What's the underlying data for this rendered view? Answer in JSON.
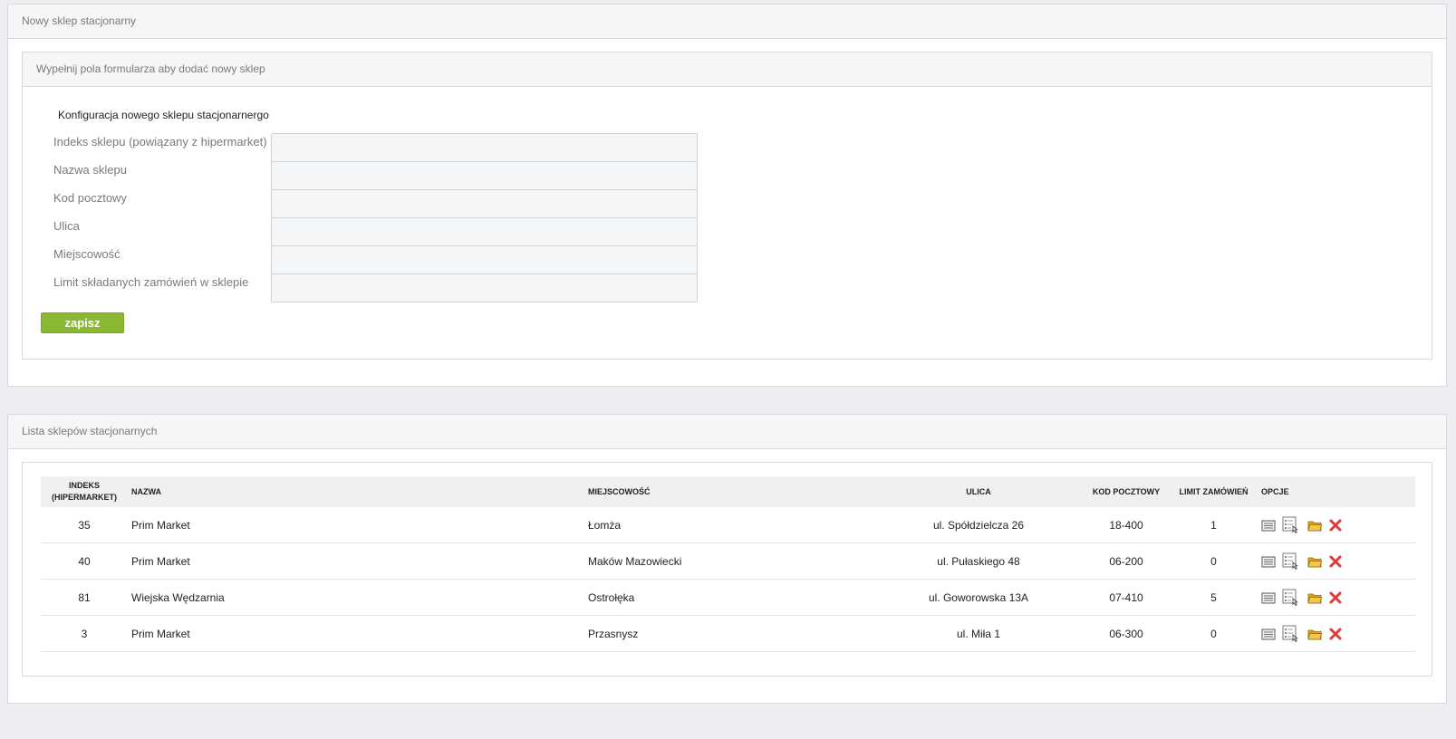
{
  "new_store_panel": {
    "title": "Nowy sklep stacjonarny",
    "inner_title": "Wypełnij pola formularza aby dodać nowy sklep",
    "form_title": "Konfiguracja nowego sklepu stacjonarnergo",
    "fields": [
      {
        "label": "Indeks sklepu (powiązany z hipermarket)",
        "value": ""
      },
      {
        "label": "Nazwa sklepu",
        "value": ""
      },
      {
        "label": "Kod pocztowy",
        "value": ""
      },
      {
        "label": "Ulica",
        "value": ""
      },
      {
        "label": "Miejscowość",
        "value": ""
      },
      {
        "label": "Limit składanych zamówień w sklepie",
        "value": ""
      }
    ],
    "save_label": "zapisz"
  },
  "list_panel": {
    "title": "Lista sklepów stacjonarnych",
    "headers": {
      "index_line1": "INDEKS",
      "index_line2": "(HIPERMARKET)",
      "name": "NAZWA",
      "city": "MIEJSCOWOŚĆ",
      "street": "ULICA",
      "postal": "KOD POCZTOWY",
      "limit": "LIMIT ZAMÓWIEŃ",
      "options": "OPCJE"
    },
    "rows": [
      {
        "index": "35",
        "name": "Prim Market",
        "city": "Łomża",
        "street": "ul. Spółdzielcza 26",
        "postal": "18-400",
        "limit": "1"
      },
      {
        "index": "40",
        "name": "Prim Market",
        "city": "Maków Mazowiecki",
        "street": "ul. Pułaskiego 48",
        "postal": "06-200",
        "limit": "0"
      },
      {
        "index": "81",
        "name": "Wiejska Wędzarnia",
        "city": "Ostrołęka",
        "street": "ul. Goworowska 13A",
        "postal": "07-410",
        "limit": "5"
      },
      {
        "index": "3",
        "name": "Prim Market",
        "city": "Przasnysz",
        "street": "ul. Miła 1",
        "postal": "06-300",
        "limit": "0"
      }
    ],
    "option_icons": [
      "list-icon",
      "select-items-icon",
      "folder-icon",
      "delete-icon"
    ]
  },
  "colors": {
    "accent_green": "#8ab833",
    "delete_red": "#e03a3a",
    "folder_yellow": "#e8b830",
    "background": "#eceef1"
  }
}
